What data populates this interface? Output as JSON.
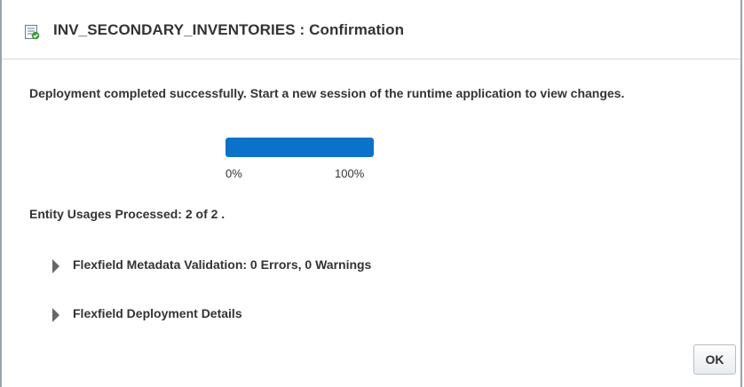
{
  "dialog": {
    "title": "INV_SECONDARY_INVENTORIES : Confirmation",
    "title_icon": "checklist-icon"
  },
  "message": "Deployment completed successfully. Start a new session of the runtime application to view changes.",
  "progress": {
    "value_percent": 100,
    "min_label": "0%",
    "max_label": "100%",
    "fill_color": "#0b72c9"
  },
  "entity_usages": "Entity Usages Processed: 2 of 2 .",
  "sections": {
    "validation": "Flexfield Metadata Validation: 0 Errors, 0 Warnings",
    "details": "Flexfield Deployment Details",
    "expander_icon": "triangle-right-icon"
  },
  "actions": {
    "ok_label": "OK"
  }
}
